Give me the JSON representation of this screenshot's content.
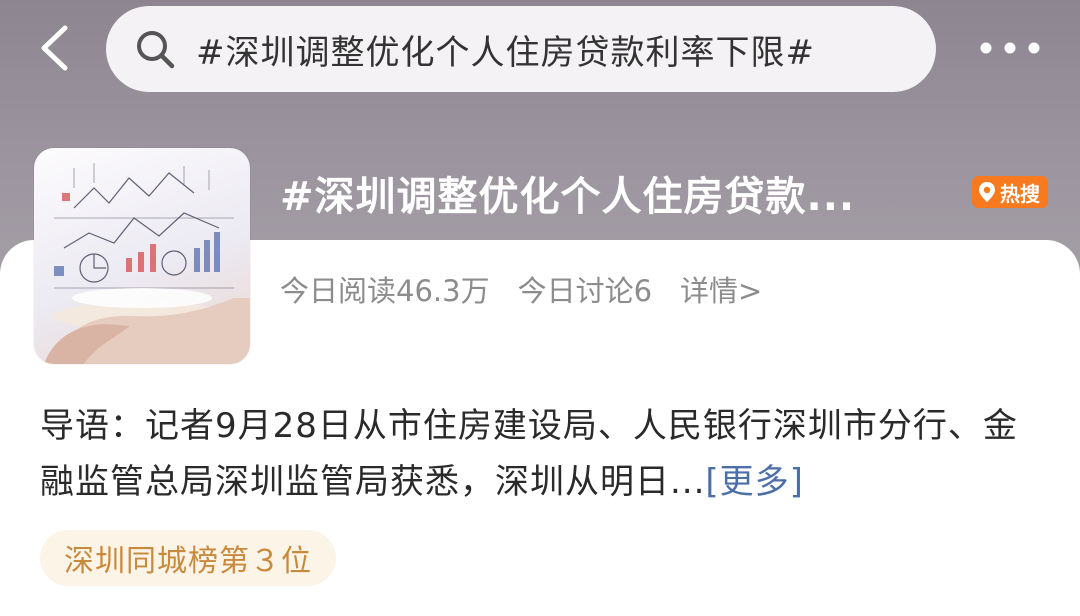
{
  "search": {
    "query": "#深圳调整优化个人住房贷款利率下限#"
  },
  "topic": {
    "title": "#深圳调整优化个人住房贷款...",
    "badge": "热搜",
    "stats": {
      "read": "今日阅读46.3万",
      "discuss": "今日讨论6",
      "detail": "详情>"
    }
  },
  "lead": {
    "text": "导语：记者9月28日从市住房建设局、人民银行深圳市分行、金融监管总局深圳监管局获悉，深圳从明日...",
    "more": "[更多]"
  },
  "rank": {
    "label": "深圳同城榜第３位"
  },
  "icons": {
    "back": "back-arrow-icon",
    "search": "search-icon",
    "more": "more-dots-icon",
    "hot": "location-pin-icon"
  },
  "colors": {
    "header": "#9a939d",
    "hot_badge": "#f77a1e",
    "link": "#4c6fa8",
    "rank_text": "#c88a3c",
    "rank_bg": "#fdf4e8"
  }
}
